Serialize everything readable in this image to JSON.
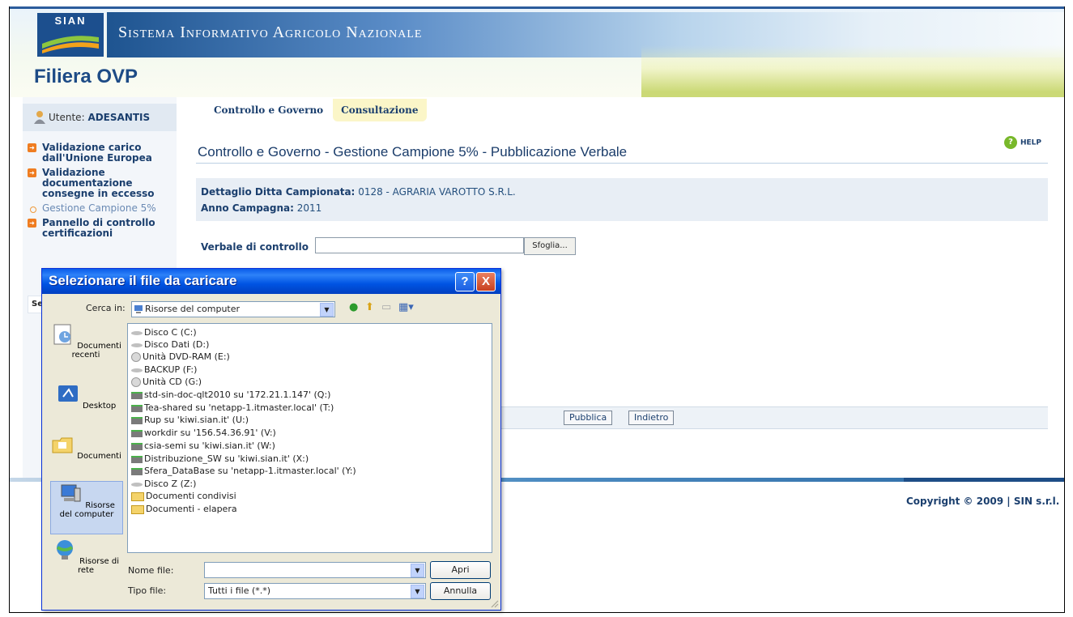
{
  "header": {
    "logo_text": "SIAN",
    "site_title": "Sistema Informativo Agricolo Nazionale",
    "app_title": "Filiera OVP"
  },
  "sidebar": {
    "user_label": "Utente:",
    "user_name": "ADESANTIS",
    "items": [
      {
        "label": "Validazione carico dall'Unione Europea",
        "type": "bold"
      },
      {
        "label": "Validazione documentazione consegne in eccesso",
        "type": "bold"
      },
      {
        "label": "Gestione Campione 5%",
        "type": "plain"
      },
      {
        "label": "Pannello di controllo certificazioni",
        "type": "bold"
      }
    ],
    "tab_label": "Se"
  },
  "tabs": [
    {
      "label": "Controllo e Governo",
      "active": false
    },
    {
      "label": "Consultazione",
      "active": true
    }
  ],
  "help_label": "HELP",
  "page_title": "Controllo e Governo - Gestione Campione 5% - Pubblicazione Verbale",
  "detail": {
    "ditta_label": "Dettaglio Ditta Campionata:",
    "ditta_value": "0128 - AGRARIA VAROTTO S.R.L.",
    "anno_label": "Anno Campagna:",
    "anno_value": "2011"
  },
  "form": {
    "verbale_label": "Verbale di controllo",
    "file_value": "",
    "browse_label": "Sfoglia..."
  },
  "actions": {
    "publish_label": "Pubblica",
    "back_label": "Indietro"
  },
  "copyright": "Copyright © 2009 | SIN s.r.l.",
  "dialog": {
    "title": "Selezionare il file da caricare",
    "lookin_label": "Cerca in:",
    "lookin_value": "Risorse del computer",
    "places": [
      {
        "label": "Documenti recenti",
        "icon": "recent-documents-icon"
      },
      {
        "label": "Desktop",
        "icon": "desktop-icon"
      },
      {
        "label": "Documenti",
        "icon": "documents-folder-icon"
      },
      {
        "label": "Risorse del computer",
        "icon": "my-computer-icon"
      },
      {
        "label": "Risorse di rete",
        "icon": "network-places-icon"
      }
    ],
    "files": [
      {
        "name": "Disco C (C:)",
        "kind": "drive"
      },
      {
        "name": "Disco Dati (D:)",
        "kind": "drive"
      },
      {
        "name": "Unità DVD-RAM (E:)",
        "kind": "cd"
      },
      {
        "name": "BACKUP (F:)",
        "kind": "drive"
      },
      {
        "name": "Unità CD (G:)",
        "kind": "cd"
      },
      {
        "name": "std-sin-doc-qlt2010 su '172.21.1.147' (Q:)",
        "kind": "net"
      },
      {
        "name": "Tea-shared su 'netapp-1.itmaster.local' (T:)",
        "kind": "net"
      },
      {
        "name": "Rup su 'kiwi.sian.it' (U:)",
        "kind": "net"
      },
      {
        "name": "workdir su '156.54.36.91' (V:)",
        "kind": "net"
      },
      {
        "name": "csia-semi su 'kiwi.sian.it' (W:)",
        "kind": "net"
      },
      {
        "name": "Distribuzione_SW su 'kiwi.sian.it' (X:)",
        "kind": "net"
      },
      {
        "name": "Sfera_DataBase su 'netapp-1.itmaster.local' (Y:)",
        "kind": "net"
      },
      {
        "name": "Disco Z (Z:)",
        "kind": "drive"
      },
      {
        "name": "Documenti condivisi",
        "kind": "folder"
      },
      {
        "name": "Documenti - elapera",
        "kind": "folder"
      }
    ],
    "filename_label": "Nome file:",
    "filename_value": "",
    "filetype_label": "Tipo file:",
    "filetype_value": "Tutti i file (*.*)",
    "open_label": "Apri",
    "cancel_label": "Annulla",
    "help_button": "?",
    "close_button": "X"
  }
}
